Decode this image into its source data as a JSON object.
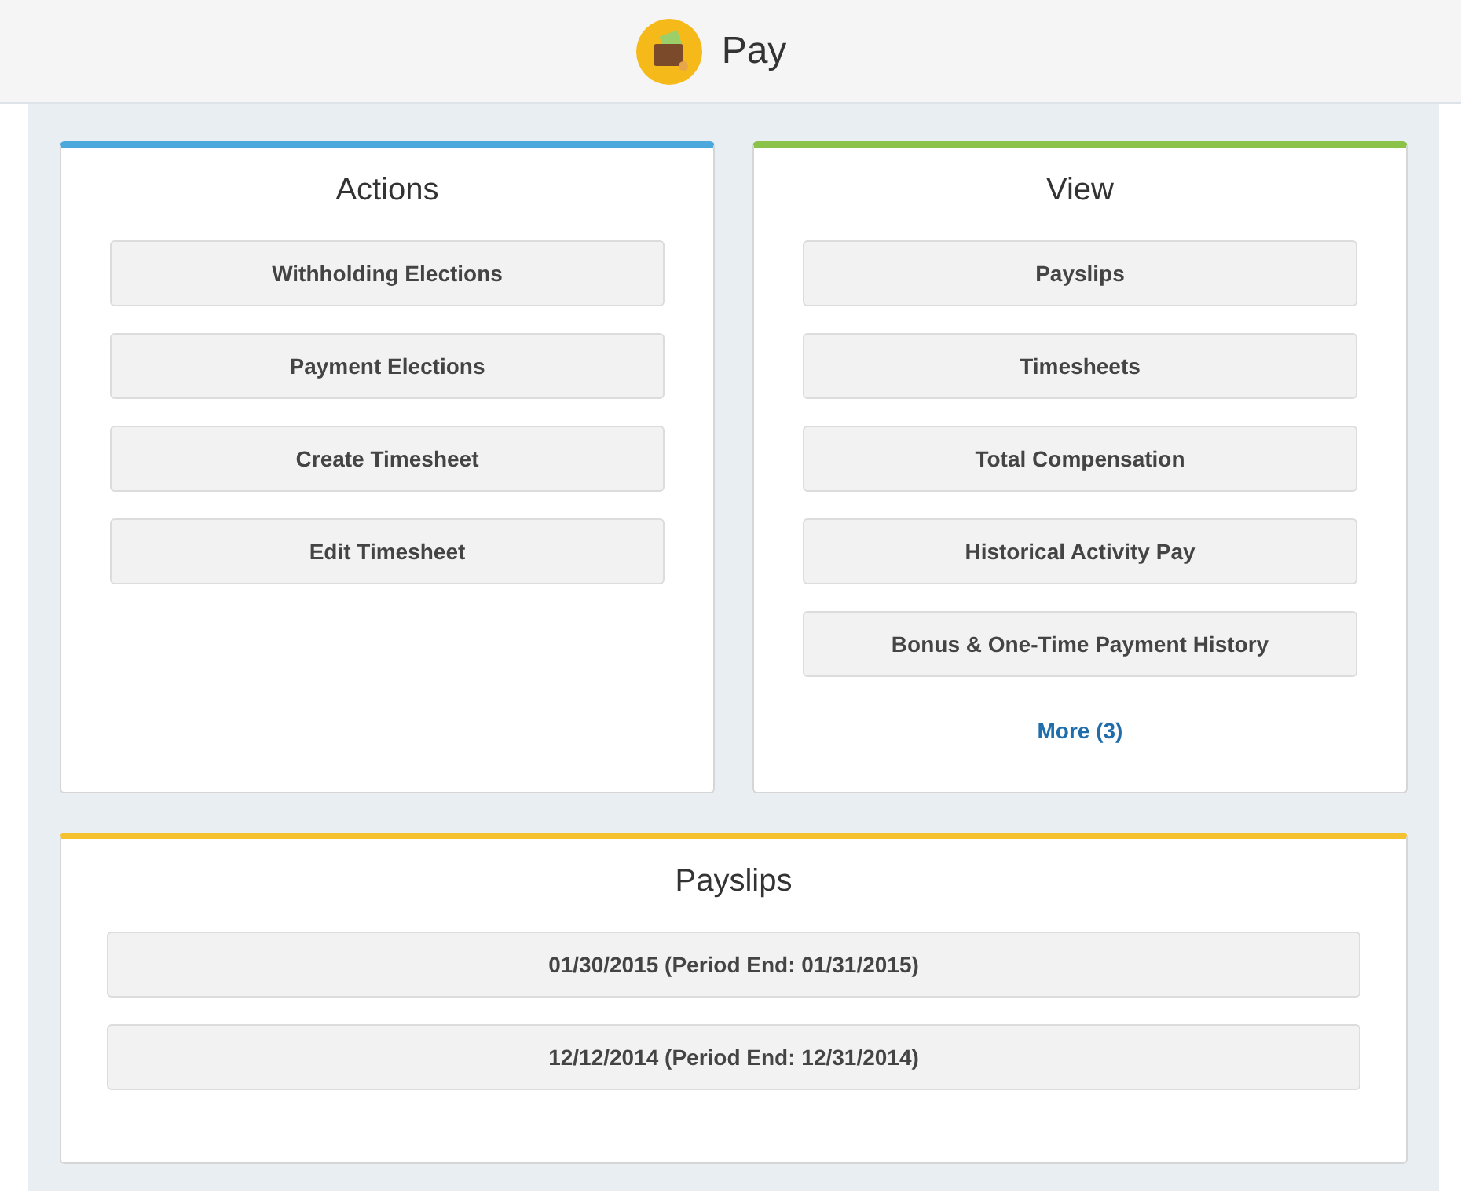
{
  "header": {
    "title": "Pay"
  },
  "cards": [
    {
      "title": "Actions",
      "color": "#4aa8dc",
      "buttons": [
        "Withholding Elections",
        "Payment Elections",
        "Create Timesheet",
        "Edit Timesheet"
      ]
    },
    {
      "title": "View",
      "color": "#8bc34a",
      "buttons": [
        "Payslips",
        "Timesheets",
        "Total Compensation",
        "Historical Activity Pay",
        "Bonus & One-Time Payment History"
      ],
      "more_link": "More (3)"
    }
  ],
  "payslips": {
    "title": "Payslips",
    "color": "#f6c12f",
    "buttons": [
      "01/30/2015 (Period End: 01/31/2015)",
      "12/12/2014 (Period End: 12/31/2014)"
    ]
  }
}
